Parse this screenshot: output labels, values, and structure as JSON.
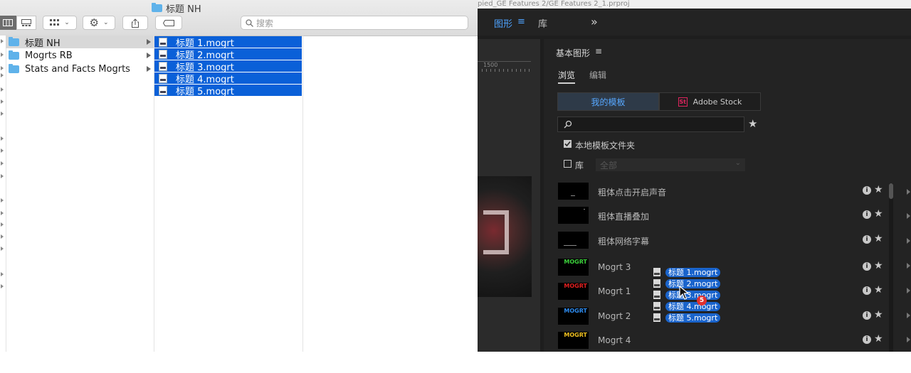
{
  "finder": {
    "window_title": "标题 NH",
    "search_placeholder": "搜索",
    "sidebar_folders": [
      {
        "label": "标题 NH",
        "selected": true
      },
      {
        "label": "Mogrts RB",
        "selected": false
      },
      {
        "label": "Stats and Facts Mogrts",
        "selected": false
      }
    ],
    "files": [
      "标题 1.mogrt",
      "标题 2.mogrt",
      "标题 3.mogrt",
      "标题 4.mogrt",
      "标题 5.mogrt"
    ]
  },
  "premiere": {
    "project_title": "pied_GE Features 2/GE Features 2_1.prproj",
    "tabs": {
      "graphics": "图形",
      "library": "库",
      "more": "»"
    },
    "ruler_label": "1500",
    "panel_title": "基本图形",
    "subtabs": {
      "browse": "浏览",
      "edit": "编辑"
    },
    "source": {
      "my_templates": "我的模板",
      "adobe_stock": "Adobe Stock",
      "stock_icon_text": "St"
    },
    "local_templates_label": "本地模板文件夹",
    "local_templates_checked": true,
    "library_label": "库",
    "library_checked": false,
    "library_select_value": "全部",
    "templates": [
      {
        "name": "粗体点击开启声音",
        "thumb_text": "",
        "thumb_color": ""
      },
      {
        "name": "粗体直播叠加",
        "thumb_text": "",
        "thumb_color": ""
      },
      {
        "name": "粗体网络字幕",
        "thumb_text": "",
        "thumb_color": ""
      },
      {
        "name": "Mogrt 3",
        "thumb_text": "MOGRT",
        "thumb_color": "#3cd23c"
      },
      {
        "name": "Mogrt 1",
        "thumb_text": "MOGRT",
        "thumb_color": "#e02020"
      },
      {
        "name": "Mogrt 2",
        "thumb_text": "MOGRT",
        "thumb_color": "#2e8cf0"
      },
      {
        "name": "Mogrt 4",
        "thumb_text": "MOGRT",
        "thumb_color": "#f0c020"
      }
    ]
  },
  "drag": {
    "items": [
      "标题 1.mogrt",
      "标题 2.mogrt",
      "标题 3.mogrt",
      "标题 4.mogrt",
      "标题 5.mogrt"
    ],
    "count_badge": "5"
  }
}
